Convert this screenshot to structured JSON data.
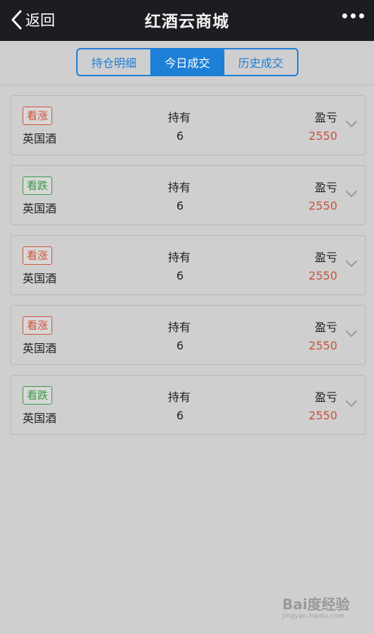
{
  "nav": {
    "back_label": "返回",
    "title": "红酒云商城"
  },
  "tabs": [
    {
      "label": "持仓明细",
      "active": false
    },
    {
      "label": "今日成交",
      "active": true
    },
    {
      "label": "历史成交",
      "active": false
    }
  ],
  "list": {
    "hold_label": "持有",
    "pnl_label": "盈亏",
    "items": [
      {
        "direction": "看涨",
        "type": "up",
        "name": "英国酒",
        "hold": "6",
        "pnl": "2550"
      },
      {
        "direction": "看跌",
        "type": "down",
        "name": "英国酒",
        "hold": "6",
        "pnl": "2550"
      },
      {
        "direction": "看涨",
        "type": "up",
        "name": "英国酒",
        "hold": "6",
        "pnl": "2550"
      },
      {
        "direction": "看涨",
        "type": "up",
        "name": "英国酒",
        "hold": "6",
        "pnl": "2550"
      },
      {
        "direction": "看跌",
        "type": "down",
        "name": "英国酒",
        "hold": "6",
        "pnl": "2550"
      }
    ]
  },
  "watermark": {
    "main": "Bai度经验",
    "sub": "jingyan.baidu.com"
  },
  "colors": {
    "navbar": "#1c1d21",
    "accent": "#1e7fd6",
    "up": "#d0523a",
    "down": "#3b9a47",
    "pnl": "#c8553d"
  }
}
